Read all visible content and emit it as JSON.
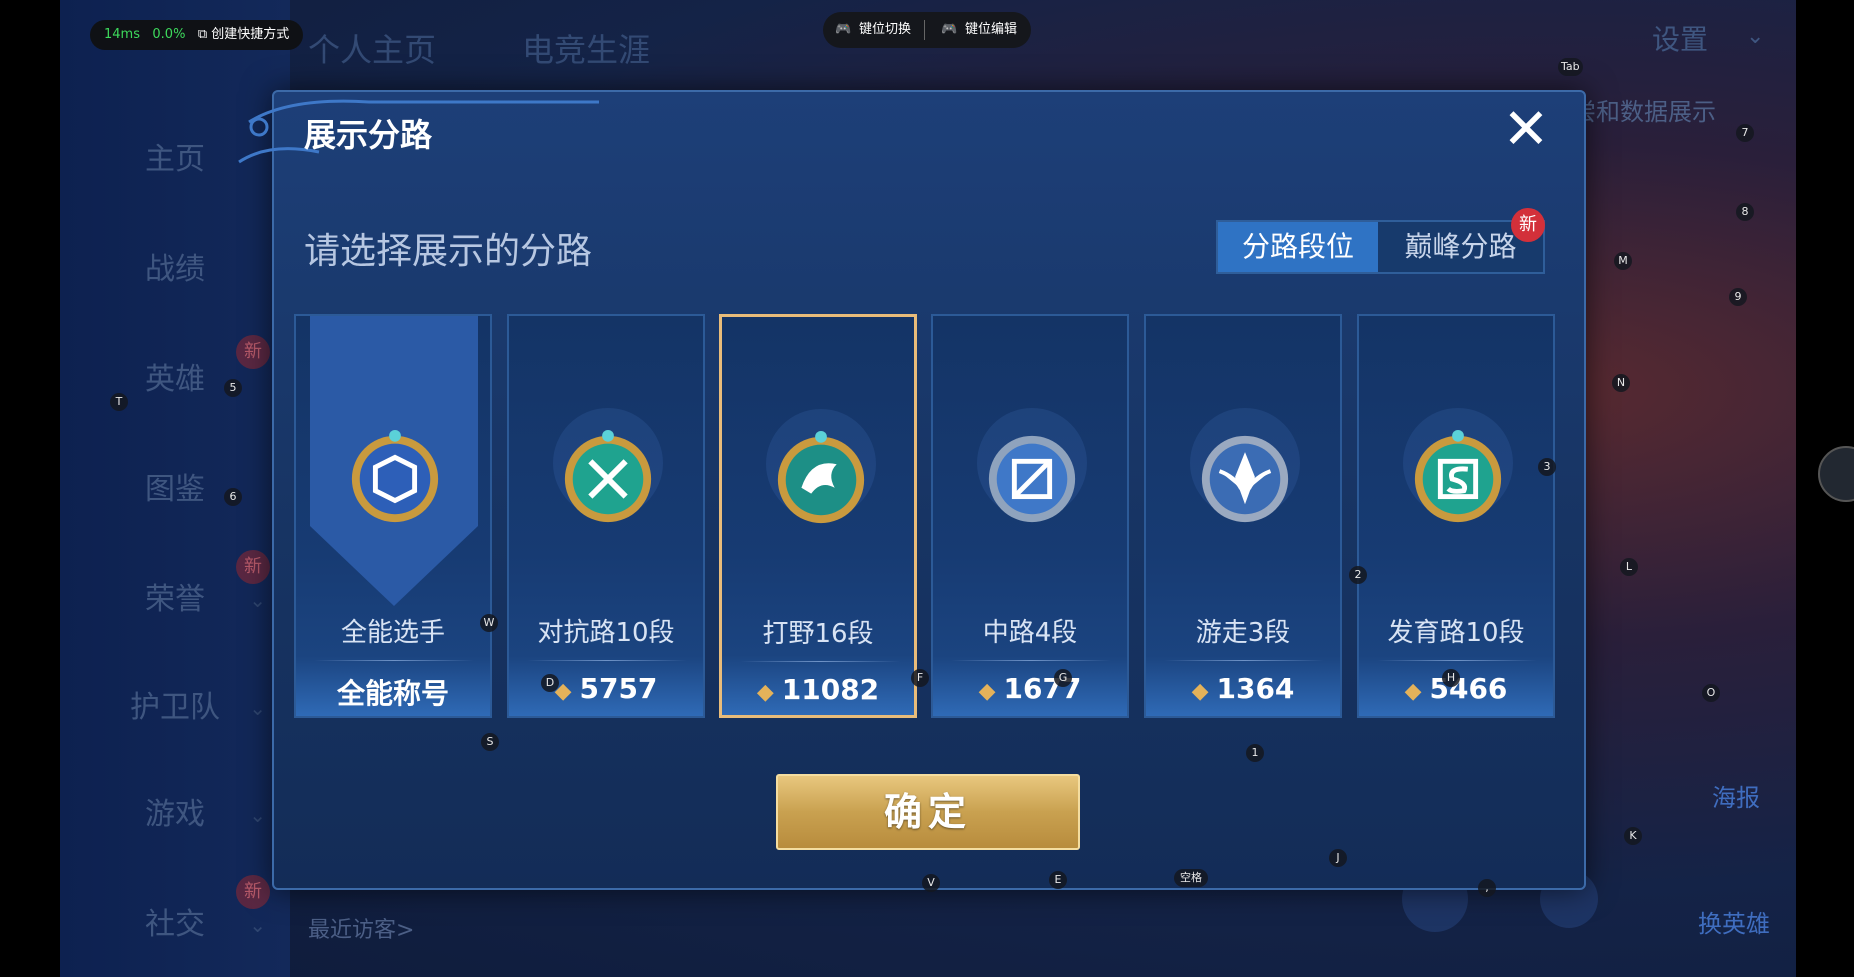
{
  "overlay": {
    "latency": "14ms",
    "loss": "0.0%",
    "shortcut_label": "创建快捷方式",
    "key_switch_label": "键位切换",
    "key_edit_label": "键位编辑"
  },
  "background": {
    "top_tabs": [
      "个人主页",
      "电竞生涯"
    ],
    "settings_label": "设置",
    "data_show_text": "尝和数据展示",
    "recent_visitors": "最近访客>",
    "poster_label": "海报",
    "change_hero_label": "换英雄",
    "sidebar": [
      {
        "label": "主页",
        "badge": ""
      },
      {
        "label": "战绩",
        "badge": ""
      },
      {
        "label": "英雄",
        "badge": "新"
      },
      {
        "label": "图鉴",
        "badge": ""
      },
      {
        "label": "荣誉",
        "badge": "新"
      },
      {
        "label": "护卫队",
        "badge": ""
      },
      {
        "label": "游戏",
        "badge": ""
      },
      {
        "label": "社交",
        "badge": "新"
      }
    ]
  },
  "dialog": {
    "title": "展示分路",
    "prompt": "请选择展示的分路",
    "toggle": {
      "option1": "分路段位",
      "option2": "巅峰分路",
      "new_badge": "新",
      "active": "分路段位"
    },
    "cards": [
      {
        "name": "全能选手",
        "score": "全能称号",
        "has_icon": false,
        "selected": false,
        "emblem": "allround-emblem-icon"
      },
      {
        "name": "对抗路10段",
        "score": "5757",
        "has_icon": true,
        "selected": false,
        "emblem": "clash-lane-emblem-icon"
      },
      {
        "name": "打野16段",
        "score": "11082",
        "has_icon": true,
        "selected": true,
        "emblem": "jungle-emblem-icon"
      },
      {
        "name": "中路4段",
        "score": "1677",
        "has_icon": true,
        "selected": false,
        "emblem": "mid-lane-emblem-icon"
      },
      {
        "name": "游走3段",
        "score": "1364",
        "has_icon": true,
        "selected": false,
        "emblem": "roam-emblem-icon"
      },
      {
        "name": "发育路10段",
        "score": "5466",
        "has_icon": true,
        "selected": false,
        "emblem": "farm-lane-emblem-icon"
      }
    ],
    "confirm_label": "确定",
    "colors": {
      "accent": "#2f73c4",
      "selected_border": "#e9bc7a",
      "confirm_gold": "#c9a150"
    }
  },
  "key_hints": [
    "Tab",
    "7",
    "8",
    "M",
    "9",
    "N",
    "5",
    "T",
    "6",
    "3",
    "2",
    "L",
    "W",
    "D",
    "F",
    "G",
    "H",
    "O",
    "S",
    "1",
    "K",
    "J",
    "V",
    "E",
    "空格",
    ","
  ]
}
